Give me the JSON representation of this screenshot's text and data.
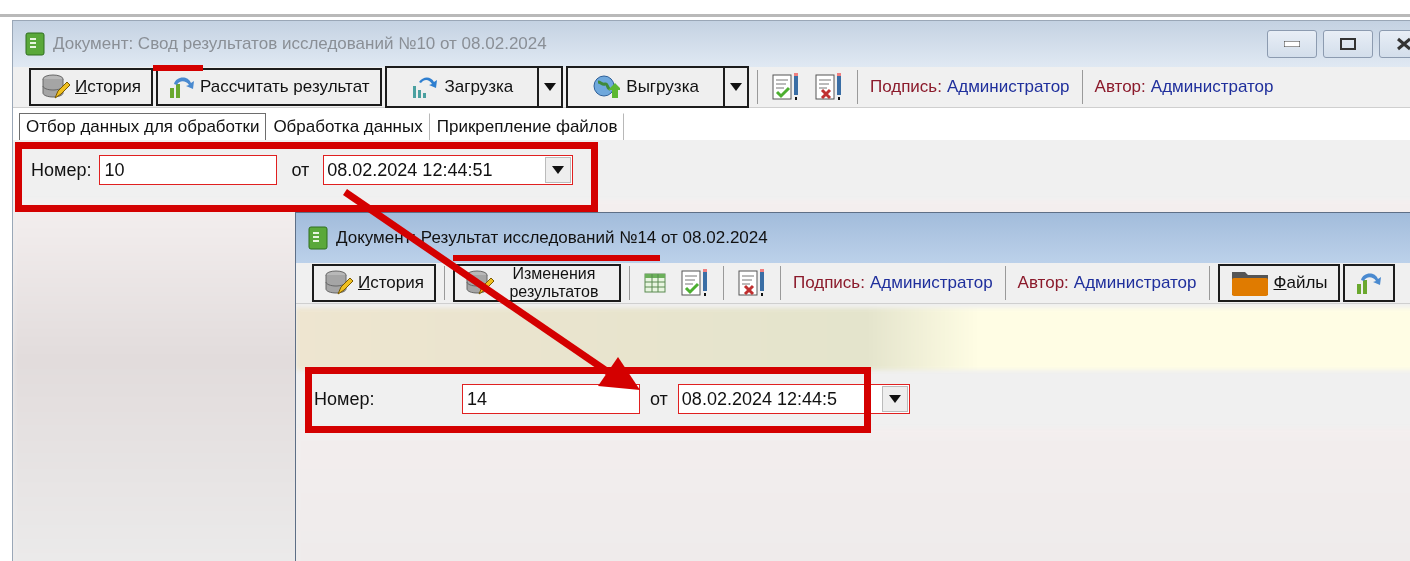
{
  "back_window": {
    "title": "Документ: Свод результатов исследований №10 от 08.02.2024",
    "active": false,
    "toolbar": [
      {
        "kind": "button",
        "label": "История",
        "underline_first": true
      },
      {
        "kind": "button",
        "label": "Рассчитать результат",
        "underline_first": false
      },
      {
        "kind": "split",
        "label": "Загрузка",
        "underline_first": false
      },
      {
        "kind": "split",
        "label": "Выгрузка",
        "underline_first": false
      },
      {
        "kind": "separator"
      },
      {
        "kind": "icon"
      },
      {
        "kind": "icon"
      },
      {
        "kind": "separator"
      },
      {
        "kind": "info",
        "label": "Подпись:",
        "value": "Администратор"
      },
      {
        "kind": "separator"
      },
      {
        "kind": "info",
        "label": "Автор:",
        "value": "Администратор"
      }
    ],
    "tabs": [
      {
        "label": "Отбор данных для обработки",
        "selected": true
      },
      {
        "label": "Обработка данных",
        "selected": false
      },
      {
        "label": "Прикрепление файлов",
        "selected": false
      }
    ],
    "form": {
      "number_label": "Номер:",
      "number": "10",
      "date_label": "от",
      "date": "08.02.2024 12:44:51"
    }
  },
  "front_window": {
    "title": "Документ: Результат исследований №14 от 08.02.2024",
    "active": true,
    "toolbar": [
      {
        "kind": "button",
        "label": "История",
        "underline_first": true
      },
      {
        "kind": "separator"
      },
      {
        "kind": "button",
        "label": "Изменения результатов",
        "underline_first": false
      },
      {
        "kind": "separator"
      },
      {
        "kind": "icon"
      },
      {
        "kind": "icon"
      },
      {
        "kind": "separator"
      },
      {
        "kind": "icon"
      },
      {
        "kind": "separator"
      },
      {
        "kind": "info",
        "label": "Подпись:",
        "value": "Администратор"
      },
      {
        "kind": "separator"
      },
      {
        "kind": "info",
        "label": "Автор:",
        "value": "Администратор"
      },
      {
        "kind": "separator"
      },
      {
        "kind": "button",
        "label": "Файлы",
        "underline_first": true
      },
      {
        "kind": "button"
      }
    ],
    "form": {
      "number_label": "Номер:",
      "number": "14",
      "date_label": "от",
      "date": "08.02.2024 12:44:5"
    }
  }
}
